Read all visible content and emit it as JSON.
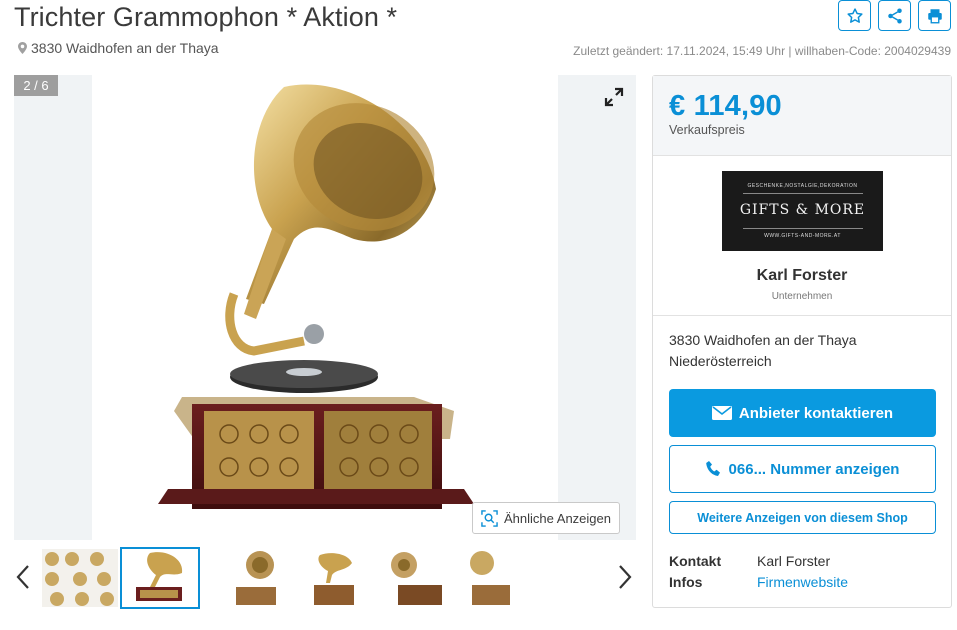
{
  "listing": {
    "title": "Trichter Grammophon * Aktion *",
    "location": "3830 Waidhofen an der Thaya",
    "meta": "Zuletzt geändert: 17.11.2024, 15:49 Uhr | willhaben-Code: 2004029439"
  },
  "actions": {
    "favorite_icon": "star-icon",
    "share_icon": "share-icon",
    "print_icon": "printer-icon"
  },
  "gallery": {
    "counter": "2 / 6",
    "similar_label": "Ähnliche Anzeigen",
    "thumbnails": [
      {
        "label": "thumb-1",
        "selected": false
      },
      {
        "label": "thumb-2",
        "selected": true
      },
      {
        "label": "thumb-3",
        "selected": false
      },
      {
        "label": "thumb-4",
        "selected": false
      },
      {
        "label": "thumb-5",
        "selected": false
      },
      {
        "label": "thumb-6",
        "selected": false
      }
    ]
  },
  "price": {
    "amount": "€ 114,90",
    "label": "Verkaufspreis"
  },
  "seller": {
    "logo_top": "GESCHENKE,NOSTALGIE,DEKORATION",
    "logo_main": "GIFTS & MORE",
    "logo_bottom": "WWW.GIFTS-AND-MORE.AT",
    "name": "Karl Forster",
    "type": "Unternehmen",
    "address_line1": "3830 Waidhofen an der Thaya",
    "address_line2": "Niederösterreich"
  },
  "buttons": {
    "contact": "Anbieter kontaktieren",
    "phone": "066... Nummer anzeigen",
    "more_ads": "Weitere Anzeigen von diesem Shop"
  },
  "infos": {
    "contact_key": "Kontakt",
    "contact_value": "Karl Forster",
    "infos_key": "Infos",
    "infos_value": "Firmenwebsite"
  },
  "colors": {
    "accent": "#0a8fd6",
    "price": "#0a8fd6"
  }
}
